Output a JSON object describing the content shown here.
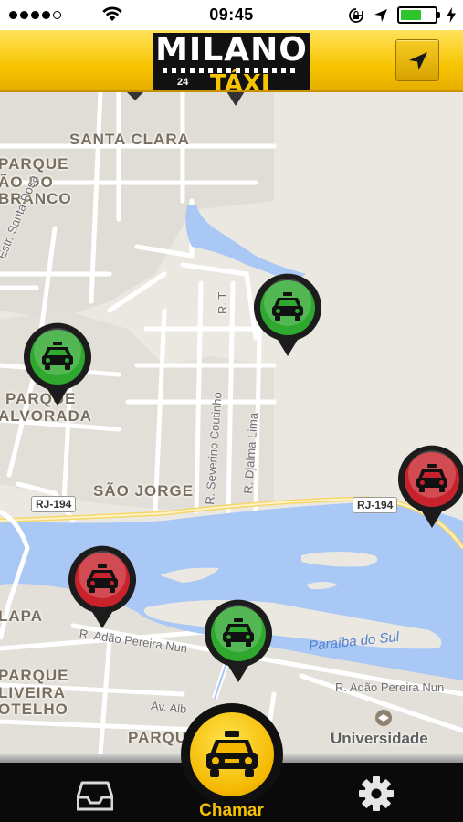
{
  "status_bar": {
    "time": "09:45",
    "signal_dots": 5,
    "signal_filled": 4,
    "battery_level": 0.62,
    "battery_color": "#2cc52c"
  },
  "header": {
    "logo_top": "MILANO",
    "logo_24": "24",
    "logo_bottom": "TÁXI",
    "accent": "#f7c400",
    "locate_icon": "navigation-arrow-icon"
  },
  "map": {
    "neighborhoods": [
      {
        "name": "SANTA CLARA"
      },
      {
        "name": "PARQUE"
      },
      {
        "name": "ÃO DO"
      },
      {
        "name": "BRANCO"
      },
      {
        "name": "PARQUE"
      },
      {
        "name": "ALVORADA"
      },
      {
        "name": "SÃO JORGE"
      },
      {
        "name": "LAPA"
      },
      {
        "name": "PARQUE"
      },
      {
        "name": "LIVEIRA"
      },
      {
        "name": "OTELHO"
      },
      {
        "name": "PARQU"
      },
      {
        "name": "Universidade"
      }
    ],
    "streets": [
      {
        "name": "Estr. Santa Rosa"
      },
      {
        "name": "R. T"
      },
      {
        "name": "R. Severino Coutinho"
      },
      {
        "name": "R. Djalma Lima"
      },
      {
        "name": "R. Adão Pereira Nun"
      },
      {
        "name": "R. Adão Pereira Nun"
      },
      {
        "name": "Av. Alb"
      }
    ],
    "river": "Paraíba do Sul",
    "road_shields": [
      "RJ-194",
      "RJ-194"
    ],
    "taxis": [
      {
        "status": "available",
        "color": "#2ea82e"
      },
      {
        "status": "available",
        "color": "#2ea82e"
      },
      {
        "status": "busy",
        "color": "#c8232c"
      },
      {
        "status": "busy",
        "color": "#c8232c"
      },
      {
        "status": "available",
        "color": "#2ea82e"
      }
    ]
  },
  "bottom_bar": {
    "inbox_icon": "inbox-tray-icon",
    "call_label": "Chamar",
    "call_icon": "taxi-icon",
    "settings_icon": "gear-icon"
  }
}
